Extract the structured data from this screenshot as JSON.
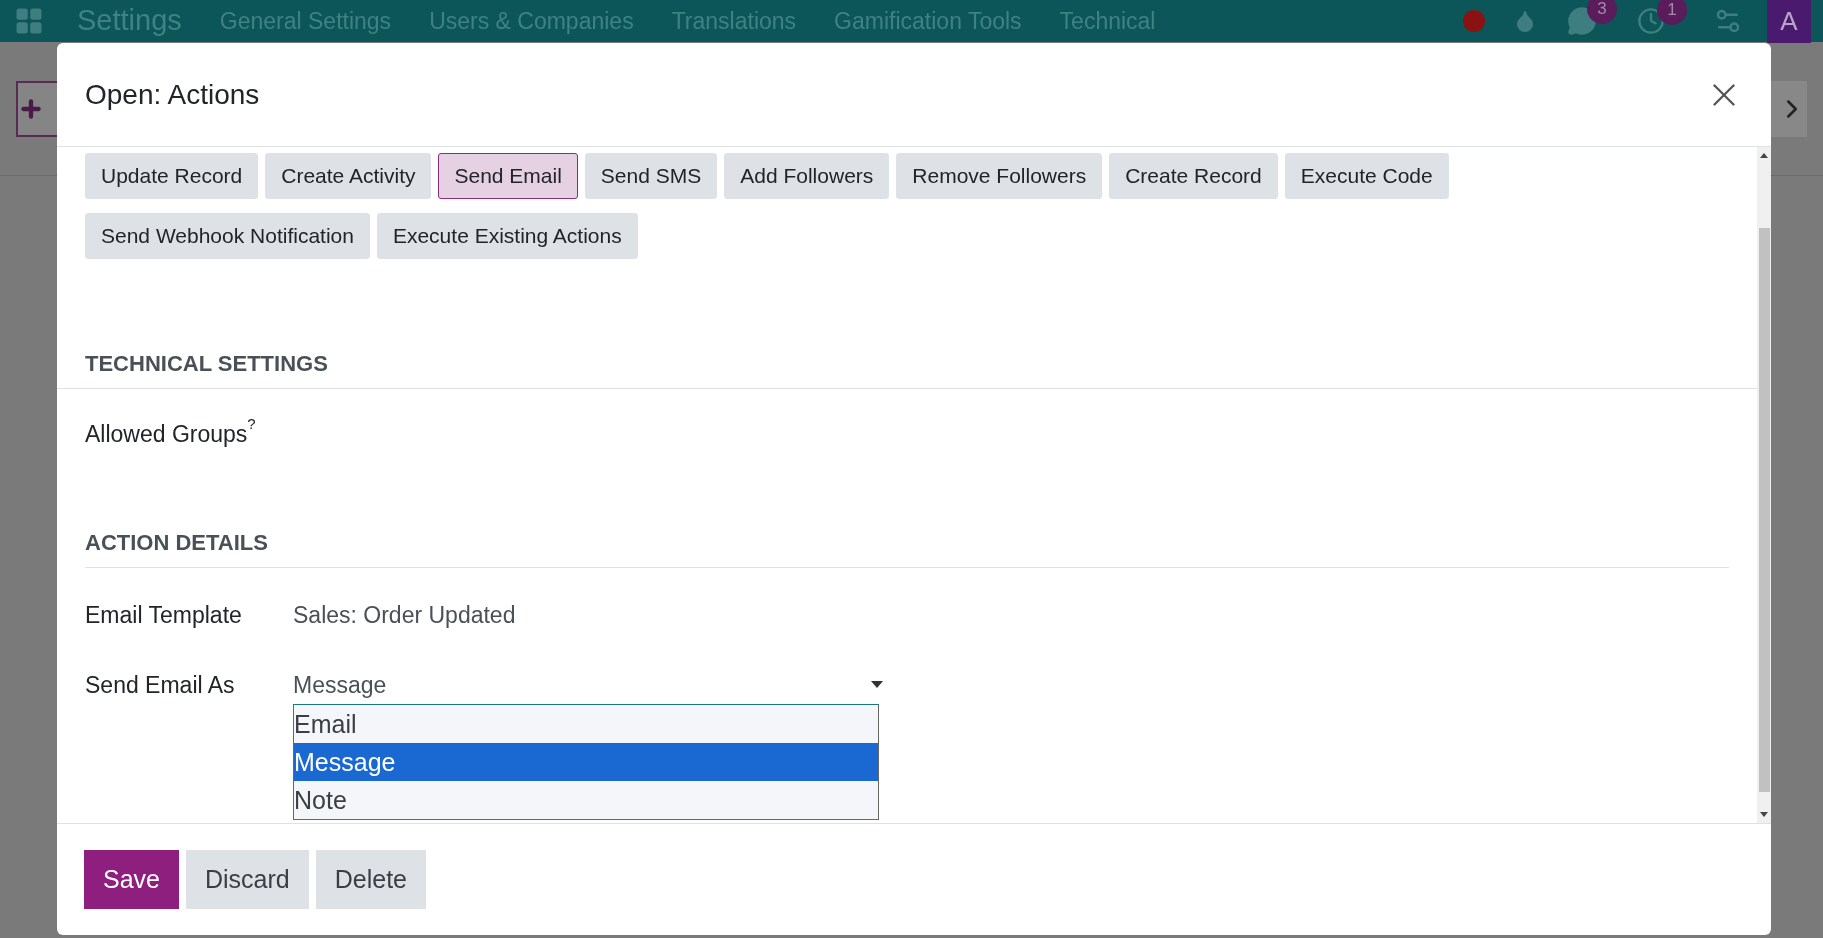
{
  "navbar": {
    "app": "Settings",
    "menu": [
      "General Settings",
      "Users & Companies",
      "Translations",
      "Gamification Tools",
      "Technical"
    ],
    "messages_count": "3",
    "activities_count": "1",
    "avatar": "A"
  },
  "dialog": {
    "title": "Open: Actions",
    "action_types": [
      {
        "label": "Update Record",
        "selected": false
      },
      {
        "label": "Create Activity",
        "selected": false
      },
      {
        "label": "Send Email",
        "selected": true
      },
      {
        "label": "Send SMS",
        "selected": false
      },
      {
        "label": "Add Followers",
        "selected": false
      },
      {
        "label": "Remove Followers",
        "selected": false
      },
      {
        "label": "Create Record",
        "selected": false
      },
      {
        "label": "Execute Code",
        "selected": false
      },
      {
        "label": "Send Webhook Notification",
        "selected": false
      },
      {
        "label": "Execute Existing Actions",
        "selected": false
      }
    ],
    "technical_settings": {
      "heading": "TECHNICAL SETTINGS",
      "allowed_groups_label": "Allowed Groups",
      "help_mark": "?"
    },
    "action_details": {
      "heading": "ACTION DETAILS",
      "email_template_label": "Email Template",
      "email_template": "Sales: Order Updated",
      "send_as_label": "Send Email As",
      "send_as_value": "Message",
      "send_as_options": [
        {
          "label": "Email",
          "selected": false
        },
        {
          "label": "Message",
          "selected": true
        },
        {
          "label": "Note",
          "selected": false
        }
      ]
    },
    "buttons": [
      {
        "label": "Save",
        "kind": "primary"
      },
      {
        "label": "Discard",
        "kind": "secondary"
      },
      {
        "label": "Delete",
        "kind": "secondary"
      }
    ]
  }
}
